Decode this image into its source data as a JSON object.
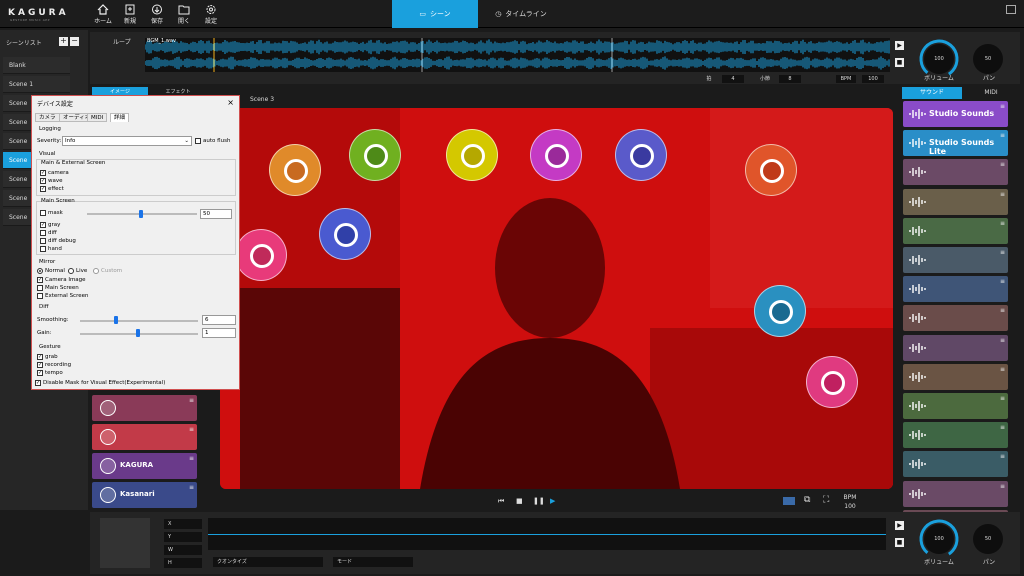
{
  "app": {
    "logo": "KAGURA",
    "logo_sub": "GESTURE MUSIC APP"
  },
  "toolbar": {
    "home": "ホーム",
    "new": "新規",
    "save": "保存",
    "open": "開く",
    "settings": "設定"
  },
  "main_tabs": {
    "scene": "シーン",
    "timeline": "タイムライン"
  },
  "scene_list": {
    "title": "シーンリスト",
    "add": "+",
    "remove": "−",
    "items": [
      "Blank",
      "Scene 1",
      "Scene",
      "Scene",
      "Scene",
      "Scene",
      "Scene",
      "Scene",
      "Scene"
    ],
    "selected_index": 5
  },
  "loop": {
    "label": "ループ",
    "track_name": "BGM_1.wav",
    "beat_label": "拍",
    "beat_value": "4",
    "bar_label": "小節",
    "bar_value": "8",
    "bpm_label": "BPM",
    "bpm_value": "100"
  },
  "volume_knob": {
    "value": "100",
    "label": "ボリューム"
  },
  "pan_knob": {
    "value": "50",
    "label": "パン"
  },
  "sub_tabs": {
    "image": "イメージ",
    "effect": "エフェクト"
  },
  "scene_header": "Scene 3",
  "sound_tabs": {
    "sound": "サウンド",
    "midi": "MIDI"
  },
  "sound_tiles": [
    {
      "label": "Studio Sounds",
      "color": "#8a4cc8"
    },
    {
      "label": "Studio Sounds Lite",
      "color": "#2a8ec8"
    },
    {
      "label": "",
      "color": "#6b4a66"
    },
    {
      "label": "",
      "color": "#6a5f4a"
    },
    {
      "label": "",
      "color": "#4a6a45"
    },
    {
      "label": "",
      "color": "#4a5a68"
    },
    {
      "label": "",
      "color": "#3f5577"
    },
    {
      "label": "",
      "color": "#6a4c4a"
    },
    {
      "label": "",
      "color": "#604866"
    },
    {
      "label": "",
      "color": "#6a5444"
    },
    {
      "label": "",
      "color": "#4c6a3e"
    },
    {
      "label": "",
      "color": "#3e6644"
    },
    {
      "label": "",
      "color": "#3a5c66"
    },
    {
      "label": "",
      "color": "#6a4a66"
    },
    {
      "label": "",
      "color": "#6a4a55"
    }
  ],
  "left_tiles": [
    {
      "label": "",
      "color": "#8a3a58"
    },
    {
      "label": "",
      "color": "#c23a48"
    },
    {
      "label": "KAGURA",
      "color": "#6a3a8a"
    },
    {
      "label": "Kasanari",
      "color": "#3a4a8a"
    }
  ],
  "player": {
    "bpm_label": "BPM",
    "bpm_value": "100"
  },
  "bottom": {
    "x": "X",
    "y": "Y",
    "w": "W",
    "h": "H",
    "quantize": "クオンタイズ",
    "mode": "モード",
    "volume_value": "100",
    "volume_label": "ボリューム",
    "pan_value": "50",
    "pan_label": "パン"
  },
  "dialog": {
    "title": "デバイス設定",
    "close": "×",
    "tabs": [
      "カメラ",
      "オーディオ",
      "MIDI",
      "詳細"
    ],
    "logging": "Logging",
    "severity_label": "Severity:",
    "severity_value": "Info",
    "auto_flush": "auto flush",
    "visual": "Visual",
    "main_external": "Main & External Screen",
    "camera": "camera",
    "wave": "wave",
    "effect": "effect",
    "main_screen": "Main Screen",
    "mask": "mask",
    "mask_value": "50",
    "gray": "gray",
    "diff": "diff",
    "diff_debug": "diff debug",
    "hand": "hand",
    "mirror": "Mirror",
    "normal": "Normal",
    "live": "Live",
    "custom": "Custom",
    "camera_image": "Camera Image",
    "main_screen_cb": "Main Screen",
    "external_screen": "External Screen",
    "diff_group": "Diff",
    "smoothing_label": "Smoothing:",
    "smoothing_value": "6",
    "gain_label": "Gain:",
    "gain_value": "1",
    "gesture": "Gesture",
    "grab": "grab",
    "recording": "recording",
    "tempo": "tempo",
    "disable_mask": "Disable Mask for Visual Effect(Experimental)"
  }
}
